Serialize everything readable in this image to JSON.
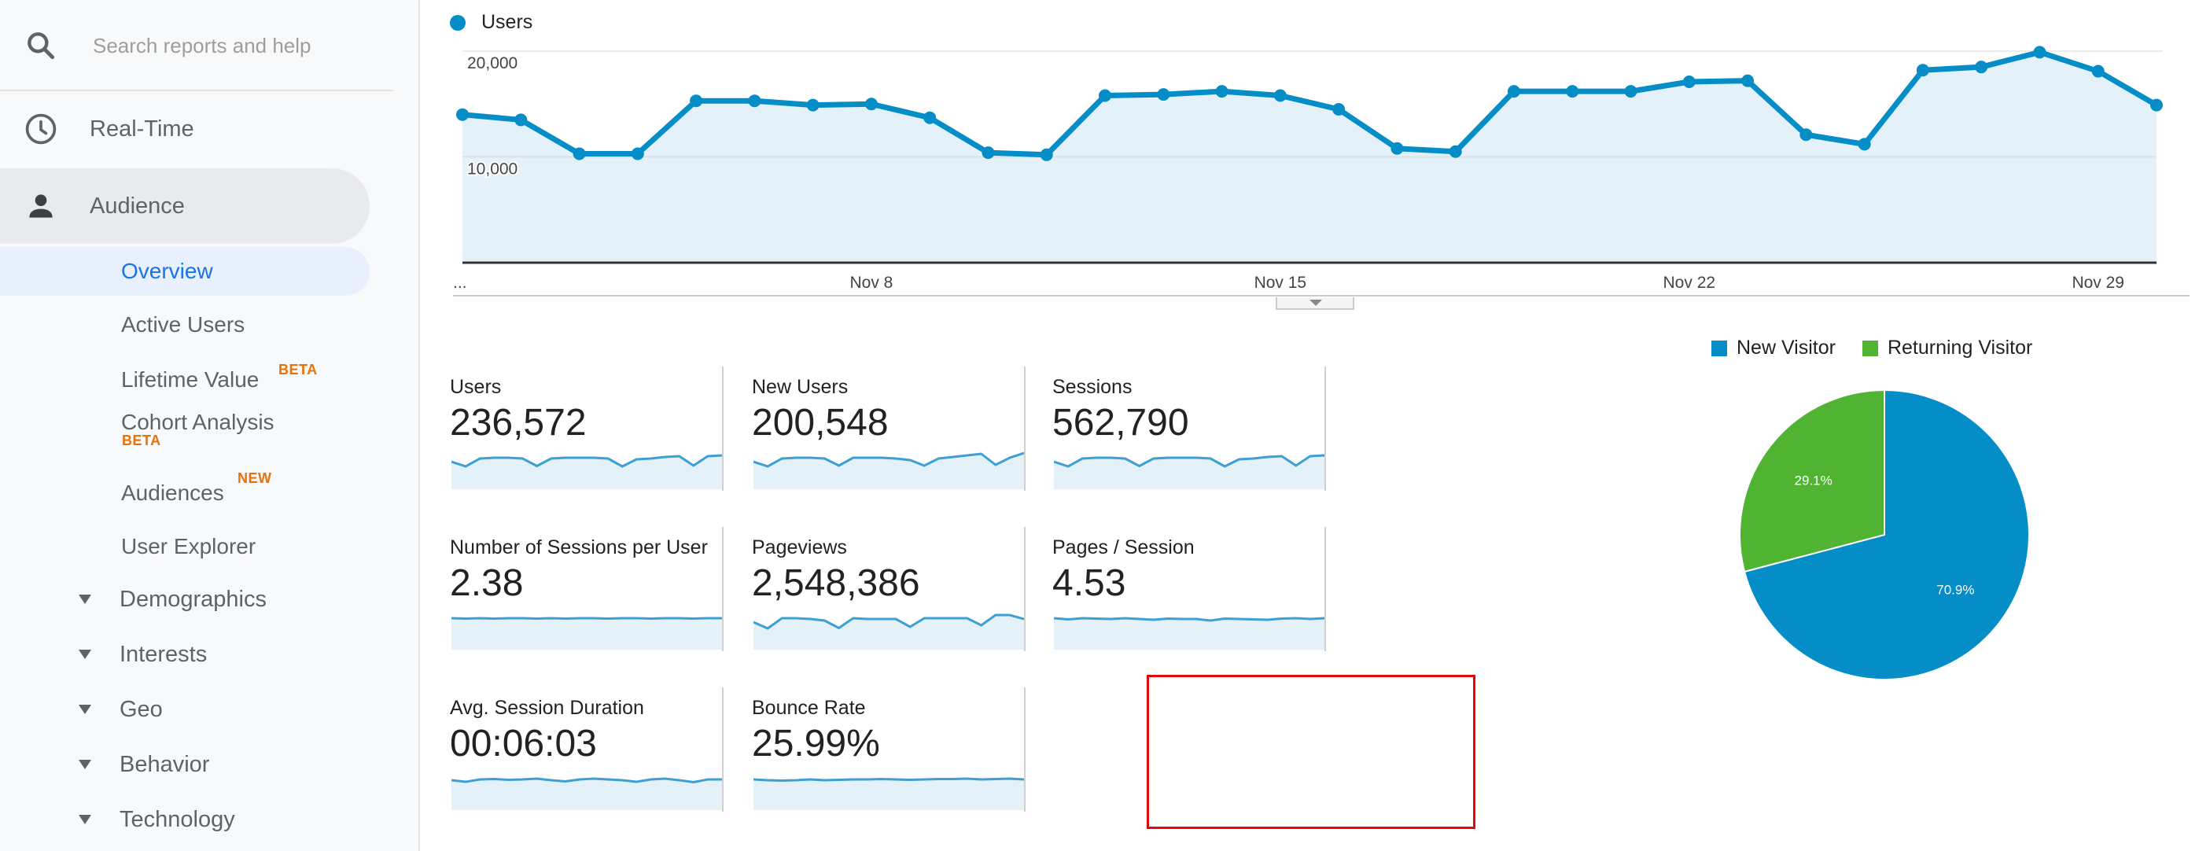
{
  "sidebar": {
    "search_placeholder": "Search reports and help",
    "realtime_label": "Real-Time",
    "audience_label": "Audience",
    "audience_items": [
      {
        "label": "Overview",
        "active": true
      },
      {
        "label": "Active Users"
      },
      {
        "label": "Lifetime Value",
        "badge": "BETA"
      },
      {
        "label": "Cohort Analysis",
        "badge": "BETA"
      },
      {
        "label": "Audiences",
        "badge": "NEW"
      },
      {
        "label": "User Explorer"
      }
    ],
    "groups": [
      {
        "label": "Demographics"
      },
      {
        "label": "Interests"
      },
      {
        "label": "Geo"
      },
      {
        "label": "Behavior"
      },
      {
        "label": "Technology"
      }
    ]
  },
  "colors": {
    "primary": "#058dc7",
    "secondary": "#50b432",
    "fill": "#e4f1f9",
    "active_blue": "#1a73e8",
    "badge_orange": "#e8710a",
    "highlight_red": "#e4080a"
  },
  "tiles": [
    {
      "label": "Users",
      "value": "236,572"
    },
    {
      "label": "New Users",
      "value": "200,548"
    },
    {
      "label": "Sessions",
      "value": "562,790"
    },
    {
      "label": "Number of Sessions per User",
      "value": "2.38"
    },
    {
      "label": "Pageviews",
      "value": "2,548,386"
    },
    {
      "label": "Pages / Session",
      "value": "4.53"
    },
    {
      "label": "Avg. Session Duration",
      "value": "00:06:03"
    },
    {
      "label": "Bounce Rate",
      "value": "25.99%",
      "highlighted": true
    }
  ],
  "chart_data": [
    {
      "type": "area",
      "title": "",
      "legend": [
        "Users"
      ],
      "legend_position": "top-left",
      "xlabel": "",
      "ylabel": "",
      "ylim": [
        0,
        22000
      ],
      "yticks": [
        10000,
        20000
      ],
      "ytick_labels": [
        "10,000",
        "20,000"
      ],
      "xtick_labels": [
        "...",
        "Nov 8",
        "Nov 15",
        "Nov 22",
        "Nov 29"
      ],
      "xtick_indices": [
        0,
        7,
        14,
        21,
        28
      ],
      "grid": true,
      "series": [
        {
          "name": "Users",
          "values": [
            14000,
            13500,
            10300,
            10300,
            15300,
            15300,
            14900,
            15000,
            13700,
            10400,
            10200,
            15800,
            15900,
            16200,
            15800,
            14500,
            10800,
            10500,
            16200,
            16200,
            16200,
            17100,
            17200,
            12100,
            11200,
            18200,
            18500,
            19900,
            18100,
            14900
          ]
        }
      ]
    },
    {
      "type": "pie",
      "title": "",
      "legend_position": "top",
      "categories": [
        "New Visitor",
        "Returning Visitor"
      ],
      "values": [
        70.9,
        29.1
      ],
      "labels": [
        "70.9%",
        "29.1%"
      ]
    }
  ]
}
